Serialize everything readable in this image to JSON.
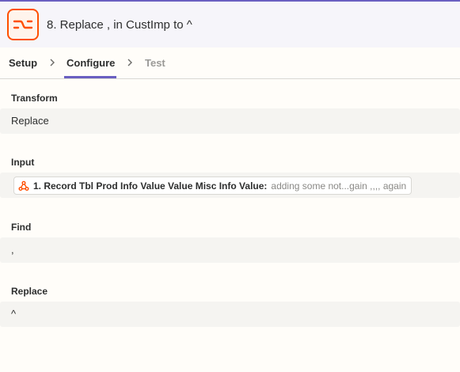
{
  "header": {
    "step_title": "8. Replace , in CustImp to ^",
    "app_icon": "transform-icon",
    "accent_color": "#ff4f00"
  },
  "tabs": [
    {
      "label": "Setup",
      "state": "default"
    },
    {
      "label": "Configure",
      "state": "active"
    },
    {
      "label": "Test",
      "state": "disabled"
    }
  ],
  "fields": {
    "transform": {
      "label": "Transform",
      "value": "Replace"
    },
    "input": {
      "label": "Input",
      "token_icon": "webhook-icon",
      "token_label": "1. Record Tbl Prod Info Value Value Misc Info Value:",
      "token_value": "adding some not...gain ,,,, again"
    },
    "find": {
      "label": "Find",
      "value": ","
    },
    "replace": {
      "label": "Replace",
      "value": "^"
    }
  }
}
